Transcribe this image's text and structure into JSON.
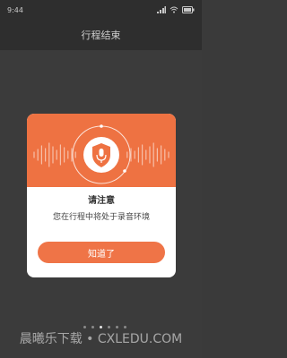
{
  "status_bar": {
    "time": "9:44"
  },
  "header": {
    "title": "行程结束"
  },
  "dialog": {
    "title": "请注意",
    "message": "您在行程中将处于录音环境",
    "button_label": "知道了"
  },
  "page_indicator": {
    "count": 6,
    "active_index": 2
  },
  "watermark": "晨曦乐下载 • CXLEDU.COM",
  "colors": {
    "accent": "#ee7242",
    "background": "#3a3a3a",
    "title_bar": "#2e2e2e"
  },
  "icons": [
    "signal-icon",
    "wifi-icon",
    "battery-icon",
    "shield-microphone-icon"
  ]
}
